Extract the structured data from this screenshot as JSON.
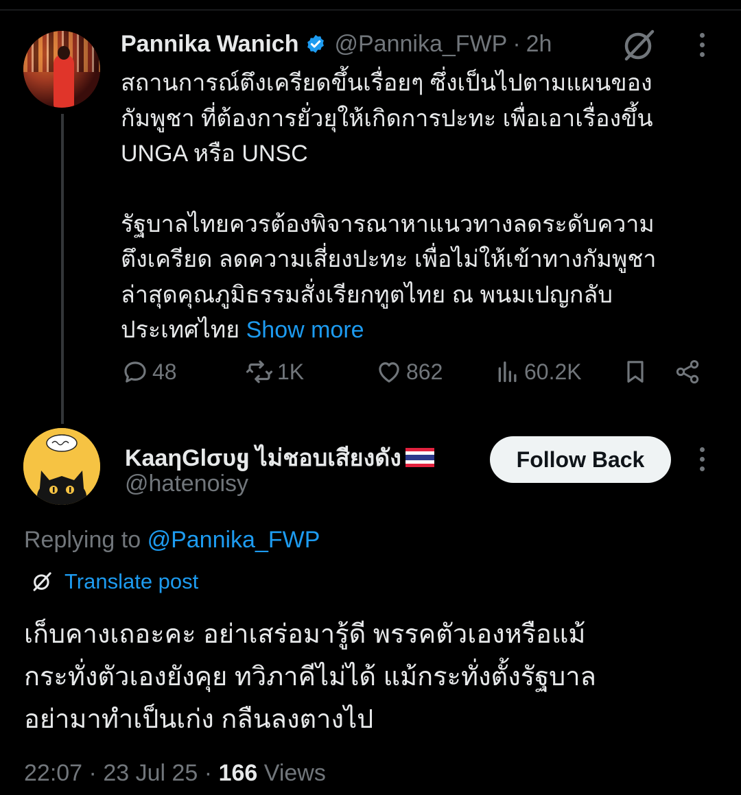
{
  "original_post": {
    "author_name": "Pannika Wanich",
    "handle": "@Pannika_FWP",
    "separator": "·",
    "time": "2h",
    "body_lines_1": [
      "สถานการณ์ตึงเครียดขึ้นเรื่อยๆ ซึ่งเป็นไปตามแผนของ",
      "กัมพูชา ที่ต้องการยั่วยุให้เกิดการปะทะ เพื่อเอาเรื่องขึ้น",
      "UNGA หรือ UNSC"
    ],
    "body_lines_2": [
      "รัฐบาลไทยควรต้องพิจารณาหาแนวทางลดระดับความ",
      "ตึงเครียด ลดความเสี่ยงปะทะ เพื่อไม่ให้เข้าทางกัมพูชา",
      "ล่าสุดคุณภูมิธรรมสั่งเรียกทูตไทย ณ พนมเปญกลับ"
    ],
    "body_last_line": "ประเทศไทย",
    "show_more": "Show more",
    "stats": {
      "replies": "48",
      "reposts": "1K",
      "likes": "862",
      "views": "60.2K"
    },
    "icons": [
      "verified-badge-icon",
      "grok-icon",
      "more-icon",
      "reply-icon",
      "repost-icon",
      "like-icon",
      "views-icon",
      "bookmark-icon",
      "share-icon"
    ]
  },
  "reply_post": {
    "author_name": "KaaηGlσυყ ไม่ชอบเสียงดัง",
    "handle": "@hatenoisy",
    "follow_button": "Follow Back",
    "replying_label": "Replying to",
    "replying_to": "@Pannika_FWP",
    "translate_label": "Translate post",
    "body_lines": [
      "เก็บคางเถอะคะ อย่าเสร่อมารู้ดี พรรคตัวเองหรือแม้",
      "กระทั่งตัวเองยังคุย ทวิภาคีไม่ได้ แม้กระทั่งตั้งรัฐบาล",
      "อย่ามาทำเป็นเก่ง กลืนลงตางไป"
    ],
    "time": "22:07",
    "date": "23 Jul 25",
    "views_count": "166",
    "views_label": "Views",
    "separator": "·"
  },
  "colors": {
    "background": "#000000",
    "text": "#e7e9ea",
    "muted": "#71767b",
    "accent": "#1d9bf0",
    "divider": "#2f3336"
  }
}
